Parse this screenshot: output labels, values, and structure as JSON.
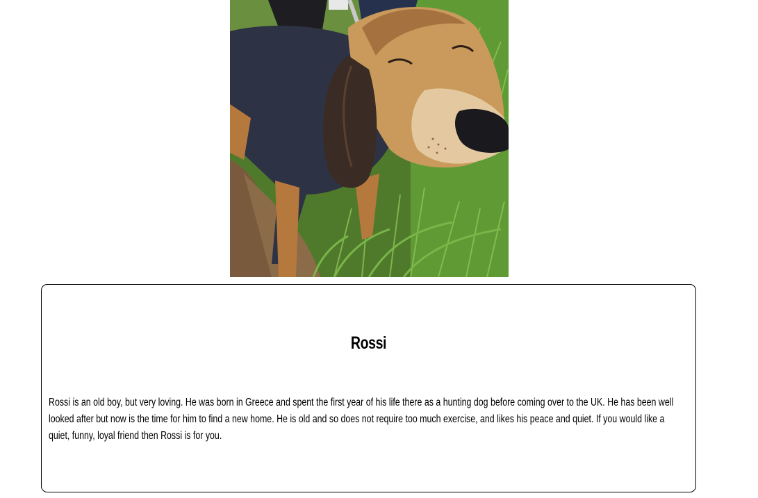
{
  "photo": {
    "alt": "Rossi"
  },
  "dog": {
    "name": "Rossi",
    "description": "Rossi is an old boy, but very loving. He was born in Greece and spent the first year of his life there as a hunting dog before coming over to the UK. He has been well looked after but now is the time for him to find a new home. He is old and so does not require too much exercise, and likes his peace and quiet. If you would like a quiet, funny, loyal friend then Rossi is for you."
  }
}
